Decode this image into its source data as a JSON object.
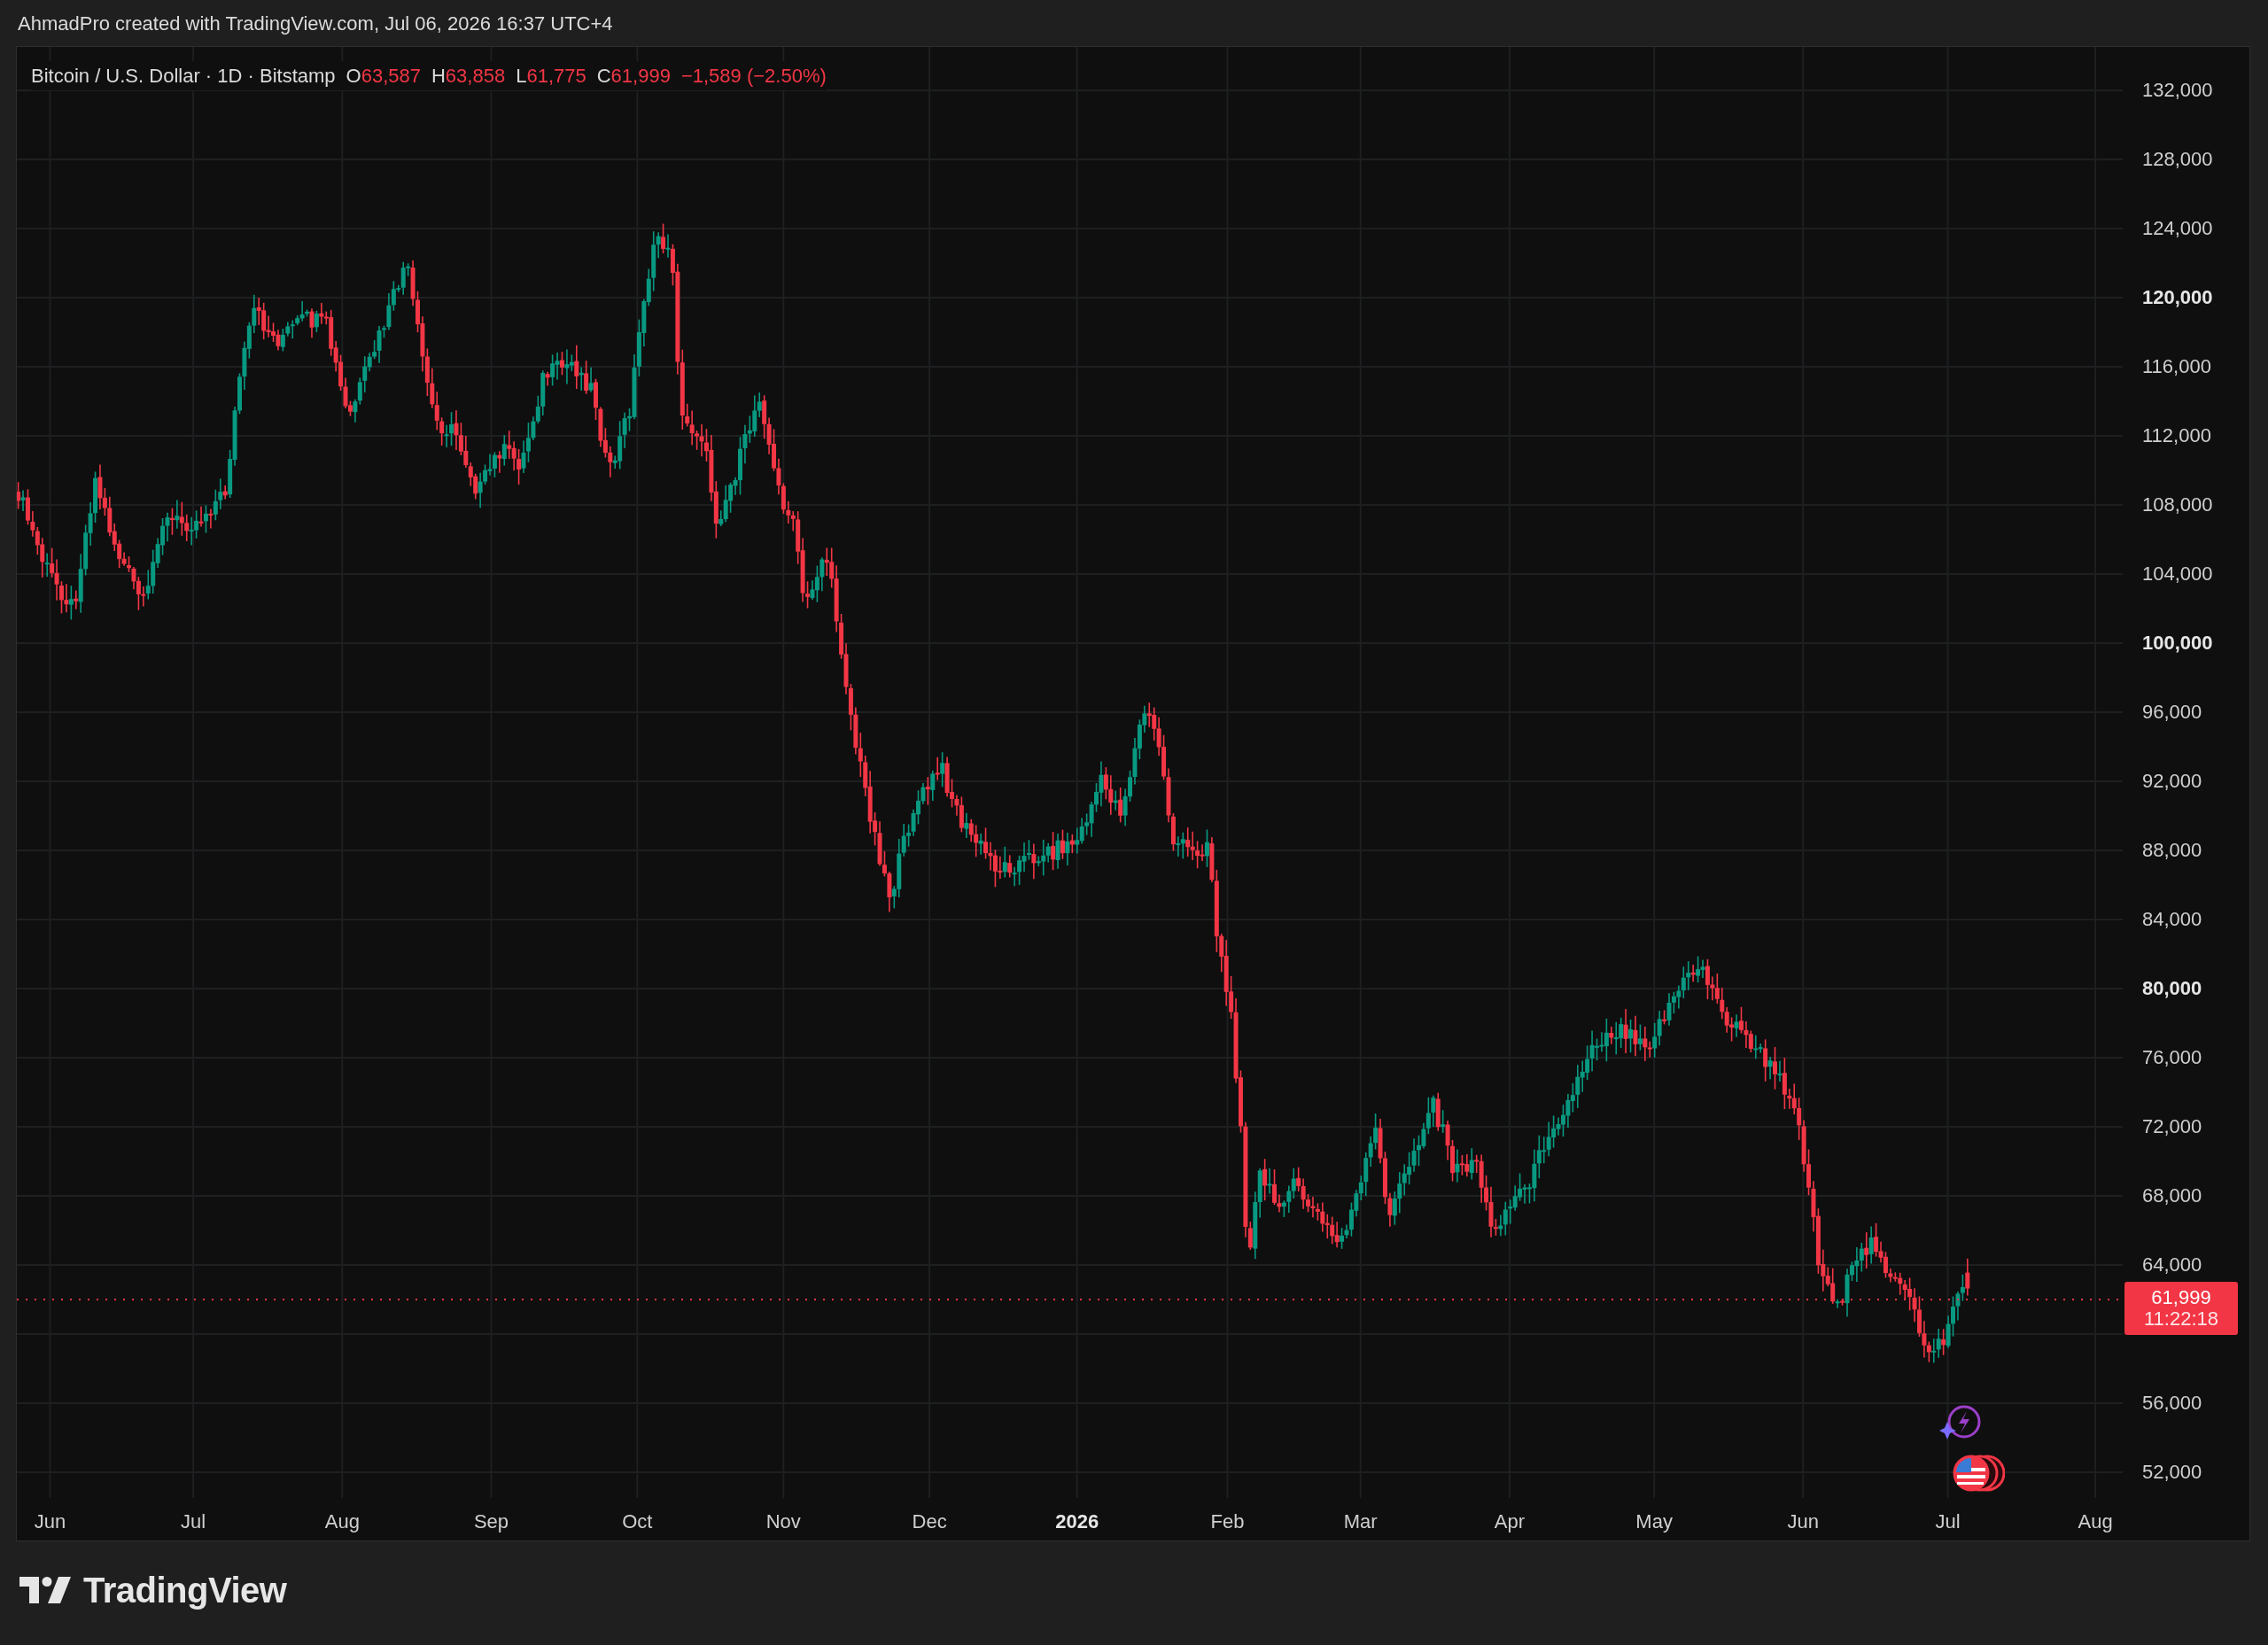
{
  "header": {
    "text": "AhmadPro created with TradingView.com, Jul 06, 2026 16:37 UTC+4"
  },
  "legend": {
    "symbol": "Bitcoin / U.S. Dollar · 1D · Bitstamp",
    "values": [
      {
        "label": "O",
        "value": "63,587"
      },
      {
        "label": "H",
        "value": "63,858"
      },
      {
        "label": "L",
        "value": "61,775"
      },
      {
        "label": "C",
        "value": "61,999"
      }
    ],
    "change": "−1,589 (−2.50%)"
  },
  "price_axis": {
    "ticks": [
      {
        "label": "132,000",
        "bold": false
      },
      {
        "label": "128,000",
        "bold": false
      },
      {
        "label": "124,000",
        "bold": false
      },
      {
        "label": "120,000",
        "bold": true
      },
      {
        "label": "116,000",
        "bold": false
      },
      {
        "label": "112,000",
        "bold": false
      },
      {
        "label": "108,000",
        "bold": false
      },
      {
        "label": "104,000",
        "bold": false
      },
      {
        "label": "100,000",
        "bold": true
      },
      {
        "label": "96,000",
        "bold": false
      },
      {
        "label": "92,000",
        "bold": false
      },
      {
        "label": "88,000",
        "bold": false
      },
      {
        "label": "84,000",
        "bold": false
      },
      {
        "label": "80,000",
        "bold": true
      },
      {
        "label": "76,000",
        "bold": false
      },
      {
        "label": "72,000",
        "bold": false
      },
      {
        "label": "68,000",
        "bold": false
      },
      {
        "label": "64,000",
        "bold": false
      },
      {
        "label": "56,000",
        "bold": false
      },
      {
        "label": "52,000",
        "bold": false
      }
    ]
  },
  "time_axis": {
    "labels": [
      {
        "label": "Jun",
        "bold": false
      },
      {
        "label": "Jul",
        "bold": false
      },
      {
        "label": "Aug",
        "bold": false
      },
      {
        "label": "Sep",
        "bold": false
      },
      {
        "label": "Oct",
        "bold": false
      },
      {
        "label": "Nov",
        "bold": false
      },
      {
        "label": "Dec",
        "bold": false
      },
      {
        "label": "2026",
        "bold": true
      },
      {
        "label": "Feb",
        "bold": false
      },
      {
        "label": "Mar",
        "bold": false
      },
      {
        "label": "Apr",
        "bold": false
      },
      {
        "label": "May",
        "bold": false
      },
      {
        "label": "Jun",
        "bold": false
      },
      {
        "label": "Jul",
        "bold": false
      },
      {
        "label": "Aug",
        "bold": false
      }
    ]
  },
  "last_price": {
    "price": "61,999",
    "countdown": "11:22:18"
  },
  "brand": {
    "name": "TradingView"
  }
}
